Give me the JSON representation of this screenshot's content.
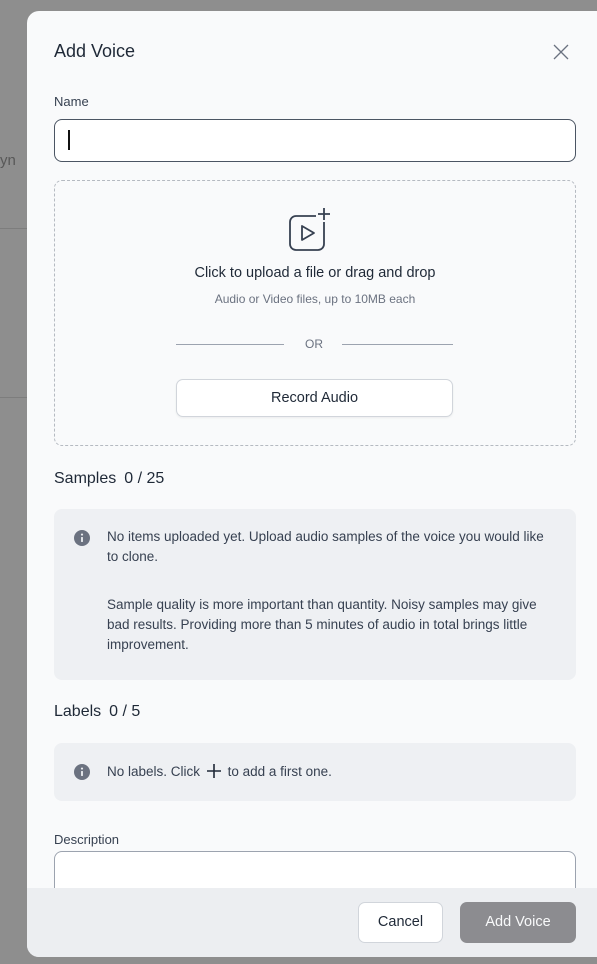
{
  "backdrop": {
    "partial_text": "yn"
  },
  "modal": {
    "title": "Add Voice",
    "name_field": {
      "label": "Name",
      "value": "",
      "placeholder": ""
    },
    "dropzone": {
      "title": "Click to upload a file or drag and drop",
      "subtitle": "Audio or Video files, up to 10MB each",
      "or_label": "OR",
      "record_label": "Record Audio"
    },
    "samples": {
      "label": "Samples",
      "count": "0 / 25",
      "info_line1": "No items uploaded yet. Upload audio samples of the voice you would like to clone.",
      "info_line2": "Sample quality is more important than quantity. Noisy samples may give bad results. Providing more than 5 minutes of audio in total brings little improvement."
    },
    "labels": {
      "label": "Labels",
      "count": "0 / 5",
      "info_before": "No labels. Click",
      "info_after": "to add a first one."
    },
    "description_field": {
      "label": "Description"
    },
    "footer": {
      "cancel_label": "Cancel",
      "submit_label": "Add Voice"
    }
  },
  "colors": {
    "overlay": "#8e8e8e",
    "modal_bg": "#f9fafb",
    "info_bg": "#eef0f3",
    "submit_disabled": "#8c8c90"
  },
  "icons": [
    "close-icon",
    "upload-video-icon",
    "info-icon",
    "plus-icon"
  ]
}
